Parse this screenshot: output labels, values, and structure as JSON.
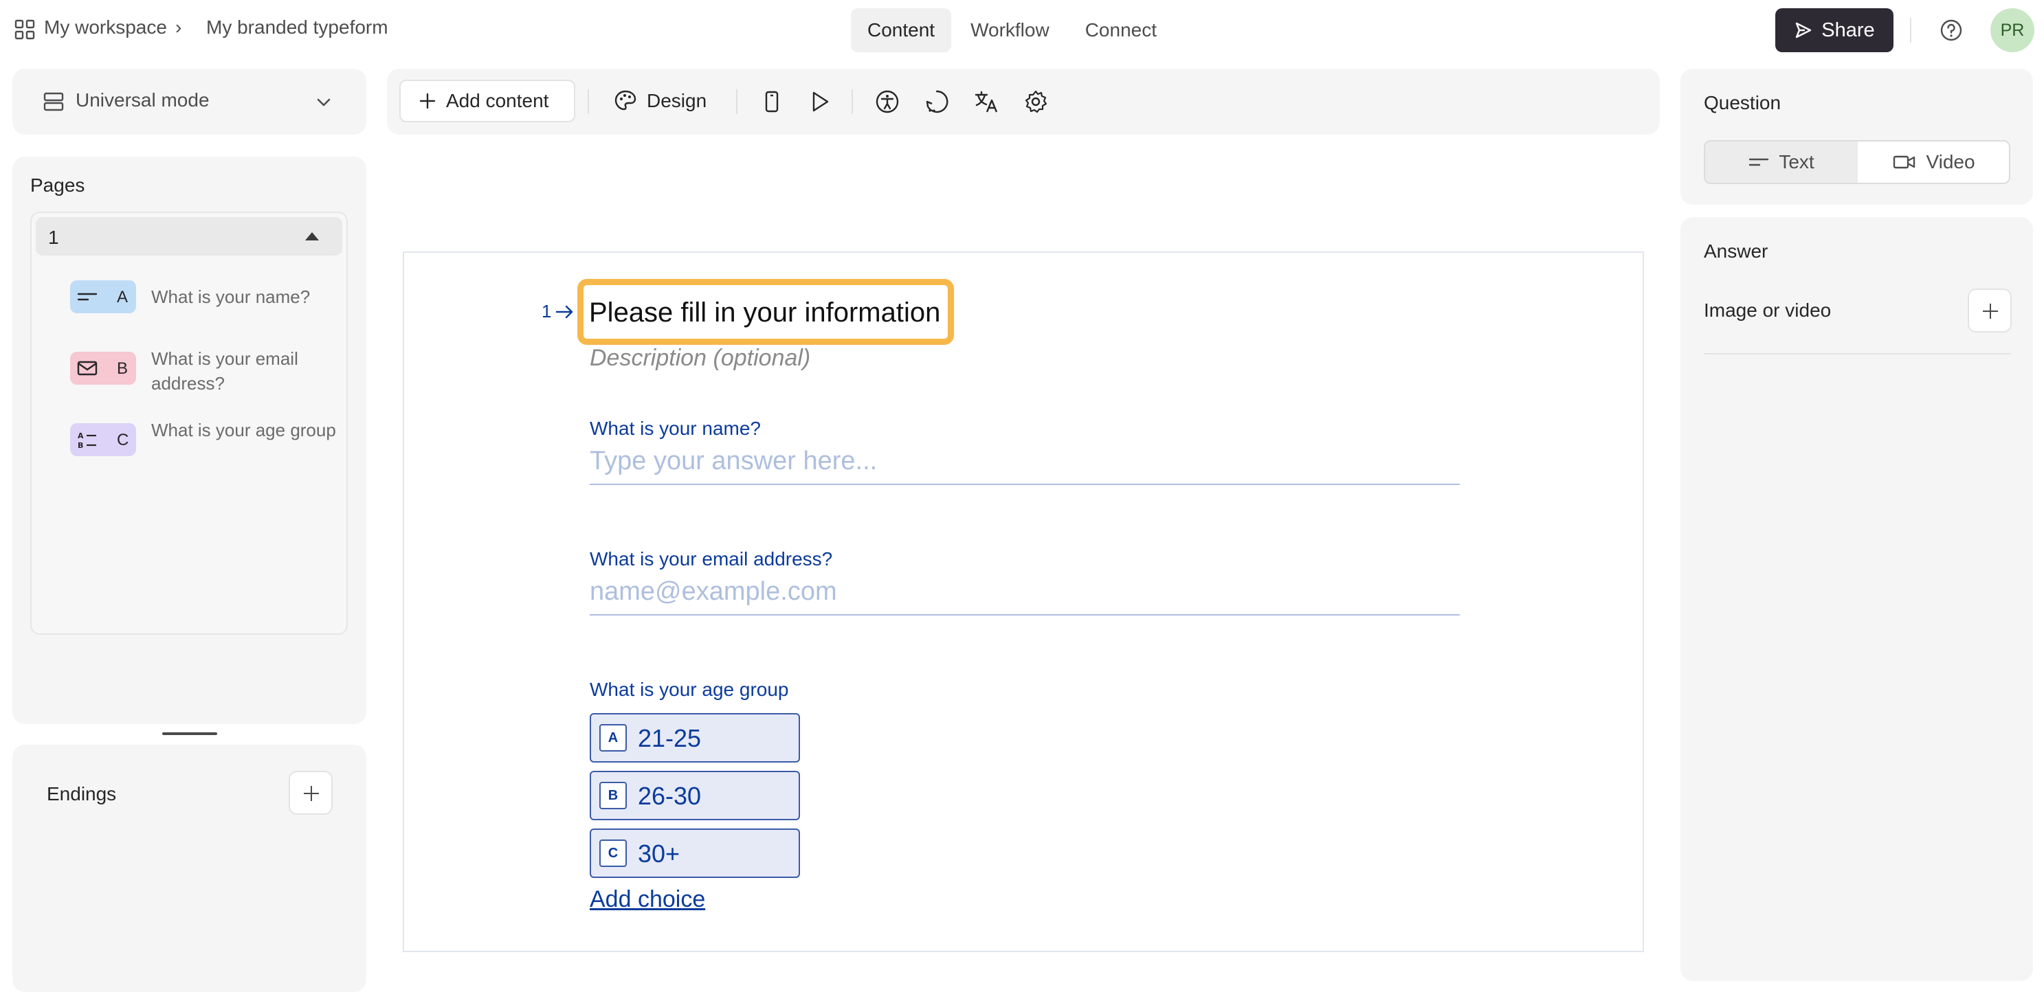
{
  "breadcrumb": {
    "workspace": "My workspace",
    "separator": "›",
    "form_name": "My branded typeform"
  },
  "top_tabs": [
    {
      "label": "Content",
      "active": true
    },
    {
      "label": "Workflow",
      "active": false
    },
    {
      "label": "Connect",
      "active": false
    }
  ],
  "share_label": "Share",
  "avatar_initials": "PR",
  "mode_selector": {
    "label": "Universal mode"
  },
  "pages": {
    "title": "Pages",
    "page_number": "1",
    "items": [
      {
        "letter": "A",
        "text": "What is your name?",
        "icon": "short-text-icon",
        "color": "#bfdcf7"
      },
      {
        "letter": "B",
        "text": "What is your email address?",
        "icon": "mail-icon",
        "color": "#f7c7d2"
      },
      {
        "letter": "C",
        "text": "What is your age group",
        "icon": "multiple-choice-icon",
        "color": "#ddd2f7"
      }
    ]
  },
  "endings": {
    "label": "Endings"
  },
  "toolbar": {
    "add_content": "Add content",
    "design": "Design"
  },
  "form": {
    "number": "1",
    "title": "Please fill in your information",
    "description": "Description (optional)",
    "fields": [
      {
        "label": "What is your name?",
        "placeholder": "Type your answer here..."
      },
      {
        "label": "What is your email address?",
        "placeholder": "name@example.com"
      },
      {
        "label": "What is your age group"
      }
    ],
    "choices": [
      {
        "key": "A",
        "value": "21-25"
      },
      {
        "key": "B",
        "value": "26-30"
      },
      {
        "key": "C",
        "value": "30+"
      }
    ],
    "add_choice": "Add choice"
  },
  "question_panel": {
    "title": "Question",
    "text_label": "Text",
    "video_label": "Video"
  },
  "answer_panel": {
    "title": "Answer",
    "image_or_video": "Image or video"
  },
  "colors": {
    "accent": "#0b3b9c",
    "highlight": "#f7b84b",
    "share_bg": "#2d2a33"
  }
}
